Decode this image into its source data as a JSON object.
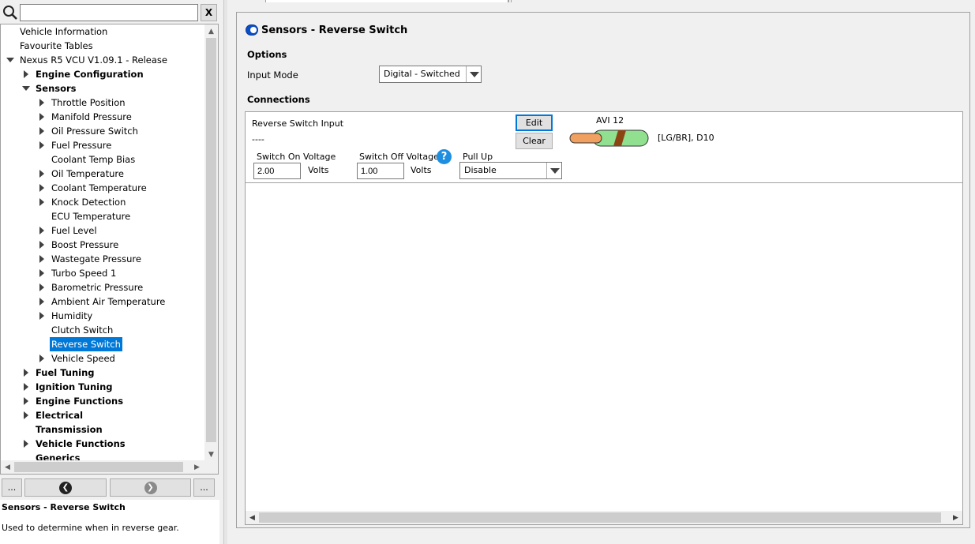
{
  "search": {
    "value": "",
    "clear_label": "X"
  },
  "tree": [
    {
      "label": "Vehicle Information",
      "level": 0,
      "arrow": "none",
      "bold": false
    },
    {
      "label": "Favourite Tables",
      "level": 0,
      "arrow": "none",
      "bold": false
    },
    {
      "label": "Nexus R5 VCU V1.09.1 - Release",
      "level": 0,
      "arrow": "expanded",
      "bold": false
    },
    {
      "label": "Engine Configuration",
      "level": 1,
      "arrow": "collapsed",
      "bold": true
    },
    {
      "label": "Sensors",
      "level": 1,
      "arrow": "expanded",
      "bold": true
    },
    {
      "label": "Throttle Position",
      "level": 2,
      "arrow": "collapsed",
      "bold": false
    },
    {
      "label": "Manifold Pressure",
      "level": 2,
      "arrow": "collapsed",
      "bold": false
    },
    {
      "label": "Oil Pressure Switch",
      "level": 2,
      "arrow": "collapsed",
      "bold": false
    },
    {
      "label": "Fuel Pressure",
      "level": 2,
      "arrow": "collapsed",
      "bold": false
    },
    {
      "label": "Coolant Temp Bias",
      "level": 2,
      "arrow": "none",
      "bold": false
    },
    {
      "label": "Oil Temperature",
      "level": 2,
      "arrow": "collapsed",
      "bold": false
    },
    {
      "label": "Coolant Temperature",
      "level": 2,
      "arrow": "collapsed",
      "bold": false
    },
    {
      "label": "Knock Detection",
      "level": 2,
      "arrow": "collapsed",
      "bold": false
    },
    {
      "label": "ECU Temperature",
      "level": 2,
      "arrow": "none",
      "bold": false
    },
    {
      "label": "Fuel Level",
      "level": 2,
      "arrow": "collapsed",
      "bold": false
    },
    {
      "label": "Boost Pressure",
      "level": 2,
      "arrow": "collapsed",
      "bold": false
    },
    {
      "label": "Wastegate Pressure",
      "level": 2,
      "arrow": "collapsed",
      "bold": false
    },
    {
      "label": "Turbo Speed 1",
      "level": 2,
      "arrow": "collapsed",
      "bold": false
    },
    {
      "label": "Barometric Pressure",
      "level": 2,
      "arrow": "collapsed",
      "bold": false
    },
    {
      "label": "Ambient Air Temperature",
      "level": 2,
      "arrow": "collapsed",
      "bold": false
    },
    {
      "label": "Humidity",
      "level": 2,
      "arrow": "collapsed",
      "bold": false
    },
    {
      "label": "Clutch Switch",
      "level": 2,
      "arrow": "none",
      "bold": false
    },
    {
      "label": "Reverse Switch",
      "level": 2,
      "arrow": "none",
      "bold": false,
      "selected": true
    },
    {
      "label": "Vehicle Speed",
      "level": 2,
      "arrow": "collapsed",
      "bold": false
    },
    {
      "label": "Fuel Tuning",
      "level": 1,
      "arrow": "collapsed",
      "bold": true
    },
    {
      "label": "Ignition Tuning",
      "level": 1,
      "arrow": "collapsed",
      "bold": true
    },
    {
      "label": "Engine Functions",
      "level": 1,
      "arrow": "collapsed",
      "bold": true
    },
    {
      "label": "Electrical",
      "level": 1,
      "arrow": "collapsed",
      "bold": true
    },
    {
      "label": "Transmission",
      "level": 1,
      "arrow": "none",
      "bold": true
    },
    {
      "label": "Vehicle Functions",
      "level": 1,
      "arrow": "collapsed",
      "bold": true
    },
    {
      "label": "Generics",
      "level": 1,
      "arrow": "none",
      "bold": true
    }
  ],
  "nav": {
    "more_left": "...",
    "more_right": "...",
    "back_glyph": "❮",
    "forward_glyph": "❯"
  },
  "help": {
    "title": "Sensors - Reverse Switch",
    "text": "Used to determine when in reverse gear."
  },
  "page": {
    "title": "Sensors - Reverse Switch",
    "options_heading": "Options",
    "input_mode_label": "Input Mode",
    "input_mode_value": "Digital - Switched",
    "connections_heading": "Connections"
  },
  "connection": {
    "input_name": "Reverse Switch Input",
    "input_value": "----",
    "edit_label": "Edit",
    "clear_label": "Clear",
    "pin_label": "AVI 12",
    "wire_info": "[LG/BR], D10",
    "wire_colors": {
      "pin": "#f0a060",
      "insulation": "#90e090",
      "stripe": "#8b4513"
    },
    "switch_on_label": "Switch On Voltage",
    "switch_on_value": "2.00",
    "switch_on_unit": "Volts",
    "switch_off_label": "Switch Off Voltage",
    "switch_off_value": "1.00",
    "switch_off_unit": "Volts",
    "help_glyph": "?",
    "pull_up_label": "Pull Up",
    "pull_up_value": "Disable"
  },
  "colors": {
    "selection": "#0078d7",
    "help_icon": "#1e8fe0",
    "title_icon": "#0a4fc7"
  }
}
